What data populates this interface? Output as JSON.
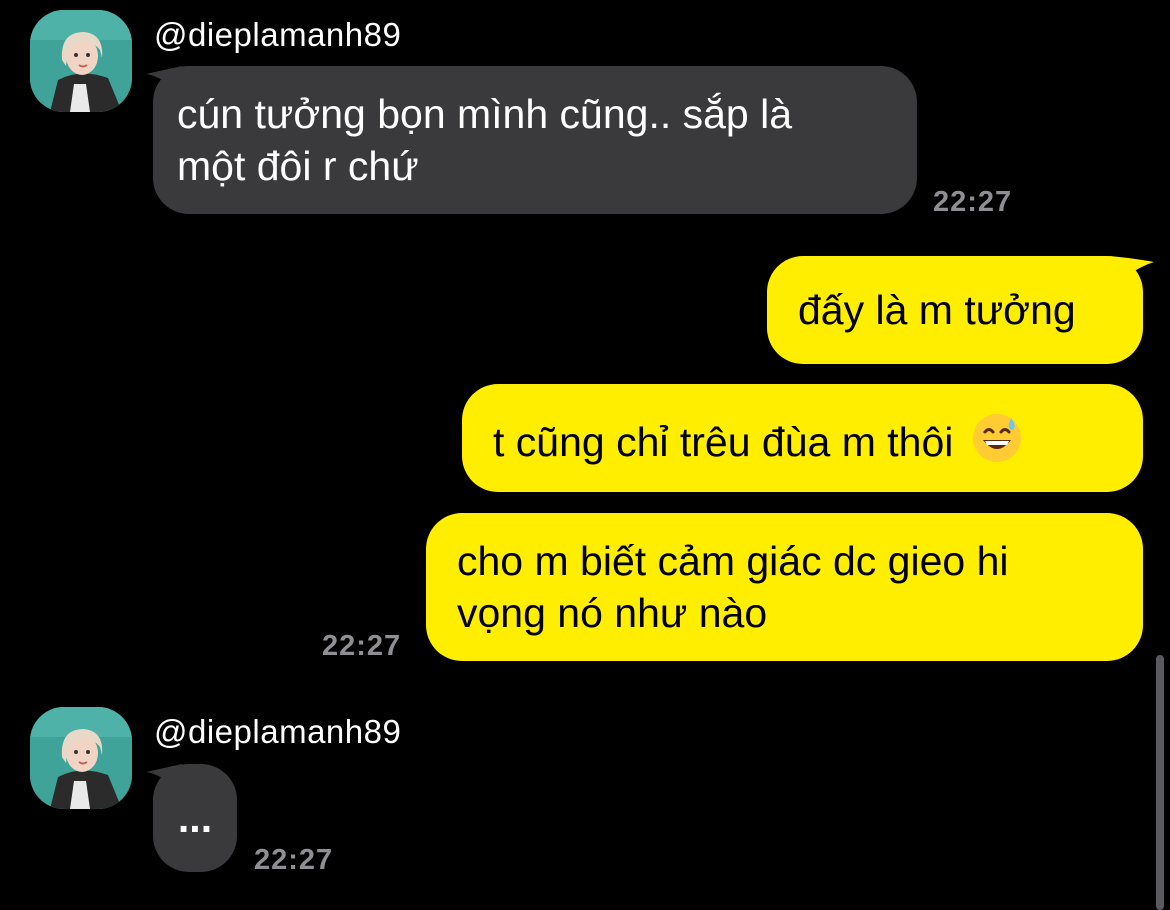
{
  "colors": {
    "background": "#000000",
    "incoming_bubble": "#3a3a3c",
    "outgoing_bubble": "#ffee00",
    "timestamp": "#8e8e93"
  },
  "group1": {
    "username": "@dieplamanh89",
    "avatar": "avatar-photo",
    "message_line1": "cún tưởng bọn mình cũng.. sắp là",
    "message_line2": "một đôi r chứ",
    "time": "22:27"
  },
  "outgoing": {
    "msg1": "đấy là m tưởng",
    "msg2": "t cũng chỉ trêu đùa m thôi",
    "msg2_emoji": "grinning-sweat-emoji",
    "msg3_line1": "cho m biết cảm giác dc gieo hi",
    "msg3_line2": "vọng nó như nào",
    "time": "22:27"
  },
  "group2": {
    "username": "@dieplamanh89",
    "avatar": "avatar-photo",
    "message": "...",
    "time": "22:27"
  }
}
